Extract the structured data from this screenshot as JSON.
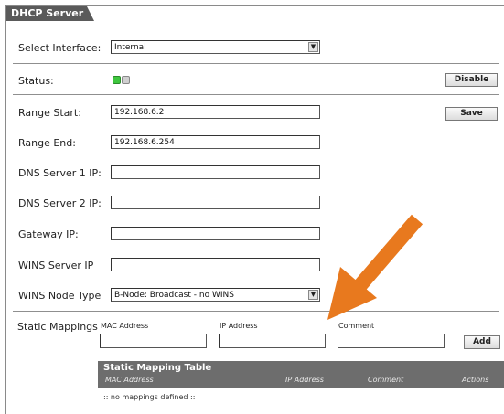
{
  "tab_title": "DHCP Server",
  "interface": {
    "label": "Select Interface:",
    "value": "Internal"
  },
  "status": {
    "label": "Status:",
    "disable_label": "Disable",
    "led_on_color": "#3ec63e",
    "led_off_color": "#cfcfcf"
  },
  "save_label": "Save",
  "fields": {
    "range_start": {
      "label": "Range Start:",
      "value": "192.168.6.2"
    },
    "range_end": {
      "label": "Range End:",
      "value": "192.168.6.254"
    },
    "dns1": {
      "label": "DNS Server 1 IP:",
      "value": ""
    },
    "dns2": {
      "label": "DNS Server 2 IP:",
      "value": ""
    },
    "gateway": {
      "label": "Gateway IP:",
      "value": ""
    },
    "wins": {
      "label": "WINS Server IP",
      "value": ""
    }
  },
  "wins_node": {
    "label": "WINS Node Type",
    "value": "B-Node: Broadcast - no WINS"
  },
  "static": {
    "label": "Static Mappings",
    "mac_label": "MAC Address",
    "ip_label": "IP Address",
    "comment_label": "Comment",
    "add_label": "Add"
  },
  "table": {
    "title": "Static Mapping Table",
    "columns": [
      "MAC Address",
      "IP Address",
      "Comment",
      "Actions"
    ],
    "empty_text": ":: no mappings defined ::"
  },
  "colors": {
    "arrow": "#e8791e",
    "header_bg": "#5a5a5a"
  },
  "icons": {
    "status_on": "green-led-icon",
    "status_off": "gray-led-icon",
    "dropdown": "chevron-down-icon",
    "annotation": "orange-arrow-icon"
  }
}
